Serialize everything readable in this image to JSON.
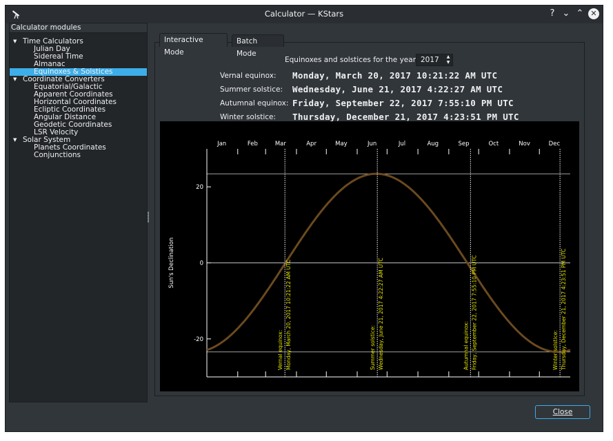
{
  "window": {
    "title": "Calculator — KStars"
  },
  "titlebar_buttons": [
    "?",
    "⌄",
    "⌃",
    "✕"
  ],
  "sidebar": {
    "header": "Calculator modules",
    "groups": [
      {
        "label": "Time Calculators",
        "items": [
          "Julian Day",
          "Sidereal Time",
          "Almanac",
          "Equinoxes & Solstices"
        ]
      },
      {
        "label": "Coordinate Converters",
        "items": [
          "Equatorial/Galactic",
          "Apparent Coordinates",
          "Horizontal Coordinates",
          "Ecliptic Coordinates",
          "Angular Distance",
          "Geodetic Coordinates",
          "LSR Velocity"
        ]
      },
      {
        "label": "Solar System",
        "items": [
          "Planets Coordinates",
          "Conjunctions"
        ]
      }
    ],
    "selected": "Equinoxes & Solstices"
  },
  "tabs": [
    {
      "label": "Interactive Mode",
      "active": true
    },
    {
      "label": "Batch Mode",
      "active": false
    }
  ],
  "year_label": "Equinoxes and solstices for the year:",
  "year_value": "2017",
  "events": [
    {
      "label": "Vernal equinox:",
      "value": "Monday, March 20, 2017 10:21:22 AM UTC"
    },
    {
      "label": "Summer solstice:",
      "value": "Wednesday, June 21, 2017 4:22:27 AM UTC"
    },
    {
      "label": "Autumnal equinox:",
      "value": "Friday, September 22, 2017 7:55:10 PM UTC"
    },
    {
      "label": "Winter solstice:",
      "value": "Thursday, December 21, 2017 4:23:51 PM UTC"
    }
  ],
  "chart_data": {
    "type": "line",
    "ylabel": "Sun's Declination",
    "month_labels": [
      "Jan",
      "Feb",
      "Mar",
      "Apr",
      "May",
      "Jun",
      "Jul",
      "Aug",
      "Sep",
      "Oct",
      "Nov",
      "Dec"
    ],
    "yticks": [
      20,
      0,
      -20
    ],
    "ylim": [
      -30,
      30
    ],
    "xlim_days": [
      0,
      365
    ],
    "horizontal_lines": [
      23.44,
      0,
      -23.44
    ],
    "curve": {
      "amplitude": 23.44,
      "phase_zero_day": 79,
      "color": "#6b4a1e"
    },
    "markers": [
      {
        "day": 78.4,
        "label_top": "Vernal equinox:",
        "label_bottom": "Monday, March 20, 2017 10:21:22 AM UTC"
      },
      {
        "day": 171.2,
        "label_top": "Summer solstice:",
        "label_bottom": "Wednesday, June 21, 2017 4:22:27 AM UTC"
      },
      {
        "day": 264.8,
        "label_top": "Autumnal equinox:",
        "label_bottom": "Friday, September 22, 2017 7:55:10 PM UTC"
      },
      {
        "day": 354.7,
        "label_top": "Winter solstice:",
        "label_bottom": "Thursday, December 21, 2017 4:23:51 PM UTC"
      }
    ],
    "colors": {
      "axis": "#ffffff",
      "marker": "#ffffff",
      "marker_text": "#e5e500",
      "text": "#ffffff"
    }
  },
  "close_button": "Close"
}
